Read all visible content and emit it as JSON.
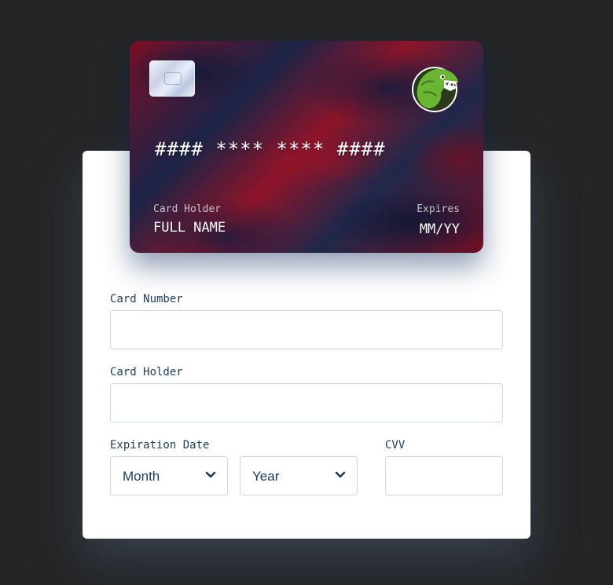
{
  "card": {
    "number_mask": "#### **** **** ####",
    "holder_caption": "Card Holder",
    "holder_name": "FULL NAME",
    "expires_caption": "Expires",
    "expires_value": "MM/YY",
    "chip_icon": "card-chip-icon",
    "logo_icon": "dinosaur-logo-icon"
  },
  "form": {
    "card_number_label": "Card Number",
    "card_number_value": "",
    "card_holder_label": "Card Holder",
    "card_holder_value": "",
    "expiration_label": "Expiration Date",
    "month_select": "Month",
    "year_select": "Year",
    "cvv_label": "CVV",
    "cvv_value": ""
  },
  "colors": {
    "page_background": "#242526",
    "panel_background": "#ffffff",
    "label_text": "#1c3b5e",
    "input_border": "#ced6e0",
    "card_red": "#8e1429",
    "card_navy": "#1b2447",
    "logo_green": "#62b234"
  }
}
